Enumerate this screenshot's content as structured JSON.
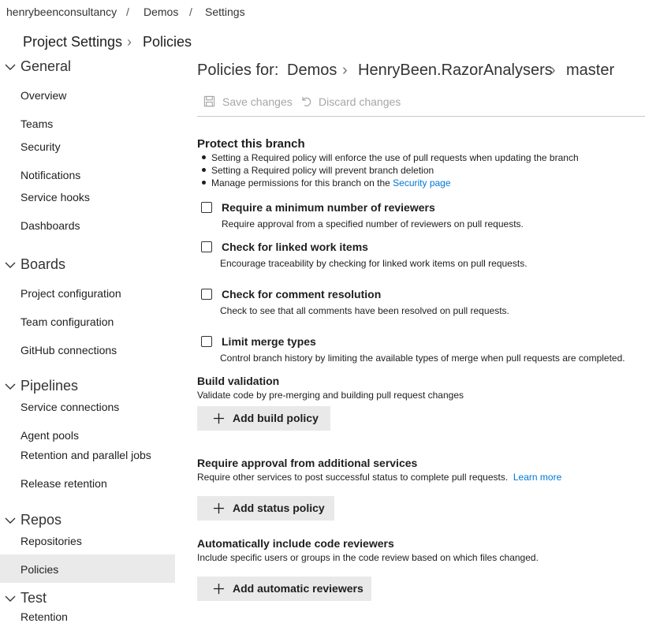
{
  "breadcrumb": {
    "org": "henrybeenconsultancy",
    "sep1": "/",
    "project": "Demos",
    "sep2": "/",
    "page": "Settings"
  },
  "page_title": {
    "root": "Project Settings",
    "sep": "›",
    "current": "Policies"
  },
  "sidebar": {
    "groups": [
      {
        "label": "General",
        "items": [
          "Overview",
          "Teams",
          "Security",
          "Notifications",
          "Service hooks",
          "Dashboards"
        ]
      },
      {
        "label": "Boards",
        "items": [
          "Project configuration",
          "Team configuration",
          "GitHub connections"
        ]
      },
      {
        "label": "Pipelines",
        "items": [
          "Service connections",
          "Agent pools",
          "Retention and parallel jobs",
          "Release retention"
        ]
      },
      {
        "label": "Repos",
        "items": [
          "Repositories",
          "Policies"
        ]
      },
      {
        "label": "Test",
        "items": [
          "Retention"
        ]
      }
    ],
    "selected": "Policies"
  },
  "header": {
    "prefix": "Policies for:",
    "project": "Demos",
    "sep1": "›",
    "repo": "HenryBeen.RazorAnalysers",
    "sep2": "›",
    "branch": "master"
  },
  "toolbar": {
    "save_label": "Save changes",
    "discard_label": "Discard changes"
  },
  "protect": {
    "title": "Protect this branch",
    "bullets": [
      "Setting a Required policy will enforce the use of pull requests when updating the branch",
      "Setting a Required policy will prevent branch deletion",
      "Manage permissions for this branch on the"
    ],
    "security_link": "Security page"
  },
  "policies": [
    {
      "label": "Require a minimum number of reviewers",
      "desc": "Require approval from a specified number of reviewers on pull requests.",
      "checked": false
    },
    {
      "label": "Check for linked work items",
      "desc": "Encourage traceability by checking for linked work items on pull requests.",
      "checked": false
    },
    {
      "label": "Check for comment resolution",
      "desc": "Check to see that all comments have been resolved on pull requests.",
      "checked": false
    },
    {
      "label": "Limit merge types",
      "desc": "Control branch history by limiting the available types of merge when pull requests are completed.",
      "checked": false
    }
  ],
  "build_validation": {
    "title": "Build validation",
    "sub": "Validate code by pre-merging and building pull request changes",
    "button": "Add build policy"
  },
  "status_checks": {
    "title": "Require approval from additional services",
    "sub": "Require other services to post successful status to complete pull requests.",
    "link": "Learn more",
    "button": "Add status policy"
  },
  "auto_reviewers": {
    "title": "Automatically include code reviewers",
    "sub": "Include specific users or groups in the code review based on which files changed.",
    "button": "Add automatic reviewers"
  },
  "colors": {
    "link": "#0078d4",
    "selected_bg": "#eaeaea",
    "button_bg": "#e9e9e9",
    "disabled_text": "#a6a6a6"
  }
}
